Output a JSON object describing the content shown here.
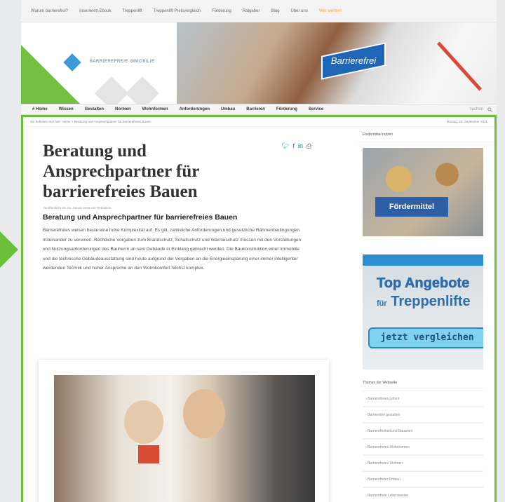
{
  "topnav": [
    "Warum barrierefrei?",
    "Inserieren Ebook",
    "Treppenlift",
    "Treppenlift Preisvergleich",
    "Förderung",
    "Ratgeber",
    "Blog",
    "Über uns",
    "Wer werben"
  ],
  "logo_text": "BARRIEREFREIE IMMOBILIE",
  "banner_sign": "Barrierefrei",
  "mainnav": [
    "# Home",
    "Wissen",
    "Gestalten",
    "Normen",
    "Wohnformen",
    "Anforderungen",
    "Umbau",
    "Barrieren",
    "Förderung",
    "Service"
  ],
  "search_placeholder": "suchen",
  "breadcrumb": "Sie befinden sich hier: Home > Beratung und Ansprechpartner für barrierefreies Bauen",
  "date": "Montag, 20. September 2021",
  "article": {
    "title": "Beratung und Ansprechpartner für barrierefreies Bauen",
    "meta": "Veröffentlicht am 18. Januar 2015 von Redaktion",
    "subtitle": "Beratung und Ansprechpartner für barrierefreies Bauen",
    "body": "Barrierefreies weisen heute eine hohe Komplexität auf. Es gilt, zahlreiche Anforderungen und gesetzliche Rahmenbedingungen miteinander zu vereinen. Rechtliche Vorgaben zum Brandschutz, Schallschutz und Wärmeschutz müssen mit den Vorstellungen und Nutzungsanforderungen des Bauherrn an sein Gebäude in Einklang gebracht werden. Die Baukonstruktion einer Immobilie und die technische Gebäudeausstattung sind heute aufgrund der Vorgaben an die Energieeinsparung einer immer intelligenter werdenden Technik und hoher Ansprüche an den Wohnkomfort höchst komplex."
  },
  "share_icons": [
    "twitter-icon",
    "facebook-icon",
    "linkedin-icon",
    "print-icon"
  ],
  "sidebar": {
    "head1": "Fördermittel nutzen",
    "ad1_label": "Fördermittel",
    "ad2_line1": "Top Angebote",
    "ad2_line2_small": "für",
    "ad2_line2": "Treppenlifte",
    "ad2_button": "jetzt vergleichen",
    "themes_head": "Themen der Webseite",
    "themes": [
      "Barrierefreies Leben",
      "Barrierefrei gestalten",
      "Barrierefreiheit und Bauarten",
      "Barrierefreies Wohnformen",
      "Barrierefreies Wohnen",
      "Barrierefreier Umbau",
      "Barrierefreie Lebensweise"
    ]
  },
  "colors": {
    "accent_green": "#6cbf3b",
    "brand_blue": "#2b6fb3",
    "highlight_orange": "#f2a93b"
  }
}
